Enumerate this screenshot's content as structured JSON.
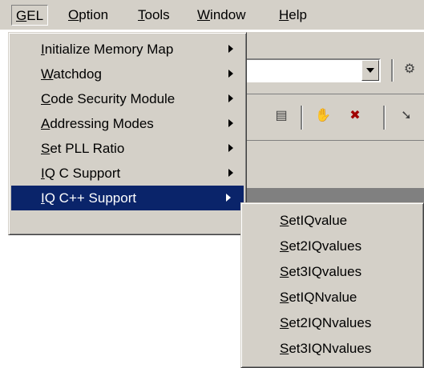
{
  "menubar": {
    "items": [
      {
        "mnemonic": "G",
        "rest": "EL"
      },
      {
        "mnemonic": "O",
        "rest": "ption"
      },
      {
        "mnemonic": "T",
        "rest": "ools"
      },
      {
        "mnemonic": "W",
        "rest": "indow"
      },
      {
        "mnemonic": "H",
        "rest": "elp"
      }
    ]
  },
  "gel_menu": {
    "items": [
      {
        "mnemonic": "I",
        "rest": "nitialize Memory Map",
        "has_submenu": true
      },
      {
        "mnemonic": "W",
        "rest": "atchdog",
        "has_submenu": true
      },
      {
        "mnemonic": "C",
        "rest": "ode Security Module",
        "has_submenu": true
      },
      {
        "mnemonic": "A",
        "rest": "ddressing Modes",
        "has_submenu": true
      },
      {
        "mnemonic": "S",
        "rest": "et PLL Ratio",
        "has_submenu": true
      },
      {
        "mnemonic": "I",
        "rest": "Q C Support",
        "has_submenu": true
      },
      {
        "mnemonic": "I",
        "rest": "Q C++ Support",
        "has_submenu": true,
        "selected": true
      }
    ]
  },
  "submenu": {
    "items": [
      {
        "mnemonic": "S",
        "rest": "etIQvalue"
      },
      {
        "mnemonic": "S",
        "rest": "et2IQvalues"
      },
      {
        "mnemonic": "S",
        "rest": "et3IQvalues"
      },
      {
        "mnemonic": "S",
        "rest": "etIQNvalue"
      },
      {
        "mnemonic": "S",
        "rest": "et2IQNvalues"
      },
      {
        "mnemonic": "S",
        "rest": "et3IQNvalues"
      }
    ]
  },
  "colors": {
    "menu_bg": "#d4d0c8",
    "highlight": "#0a246a",
    "highlight_text": "#ffffff"
  }
}
